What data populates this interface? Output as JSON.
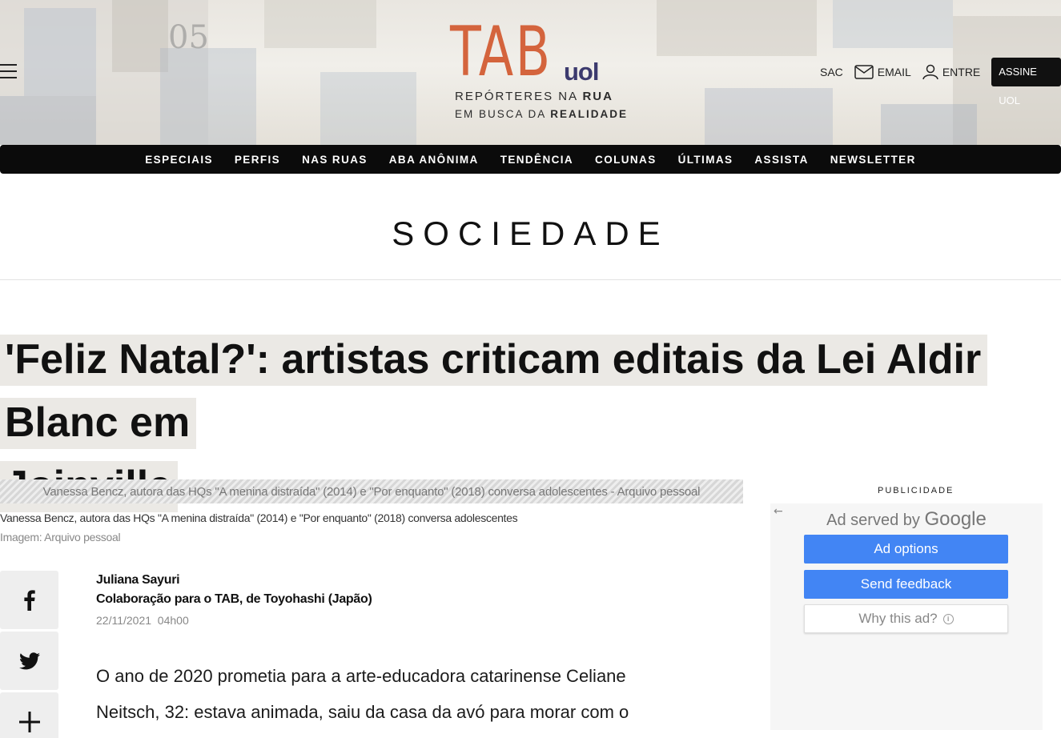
{
  "header": {
    "logo": {
      "brand": "TAB",
      "sub_brand": "uol",
      "tagline_1_prefix": "REPÓRTERES NA ",
      "tagline_1_bold": "RUA",
      "tagline_2_prefix": "EM BUSCA DA ",
      "tagline_2_bold": "REALIDADE"
    },
    "actions": {
      "sac_label": "SAC",
      "email_label": "EMAIL",
      "login_label": "ENTRE",
      "subscribe_label": "ASSINE UOL"
    },
    "nav": [
      "ESPECIAIS",
      "PERFIS",
      "NAS RUAS",
      "ABA ANÔNIMA",
      "TENDÊNCIA",
      "COLUNAS",
      "ÚLTIMAS",
      "ASSISTA",
      "NEWSLETTER"
    ]
  },
  "section": {
    "title": "SOCIEDADE"
  },
  "article": {
    "headline_line1": "'Feliz Natal?': artistas criticam editais da Lei Aldir Blanc em",
    "headline_line2": "Joinville",
    "image_alt": "Vanessa Bencz, autora das HQs \"A menina distraída\" (2014) e \"Por enquanto\" (2018) conversa adolescentes - Arquivo pessoal",
    "caption": "Vanessa Bencz, autora das HQs \"A menina distraída\" (2014) e \"Por enquanto\" (2018) conversa adolescentes",
    "credit": "Imagem: Arquivo pessoal",
    "author": "Juliana Sayuri",
    "author_role": "Colaboração para o TAB, de Toyohashi (Japão)",
    "date": "22/11/2021  04h00",
    "body_line1": "O ano de 2020 prometia para a arte-educadora catarinense Celiane",
    "body_line2": "Neitsch, 32: estava animada, saiu da casa da avó para morar com o"
  },
  "share": {
    "icons": [
      "facebook-icon",
      "twitter-icon",
      "plus-icon"
    ]
  },
  "ad": {
    "label": "PUBLICIDADE",
    "served_by": "Ad served by",
    "served_brand": "Google",
    "options_label": "Ad options",
    "feedback_label": "Send feedback",
    "why_label": "Why this ad?"
  },
  "colors": {
    "brand_orange": "#d4643d",
    "uol_purple": "#3c3a6e",
    "nav_bg": "#0b0b0b",
    "ad_blue": "#4285f4"
  }
}
